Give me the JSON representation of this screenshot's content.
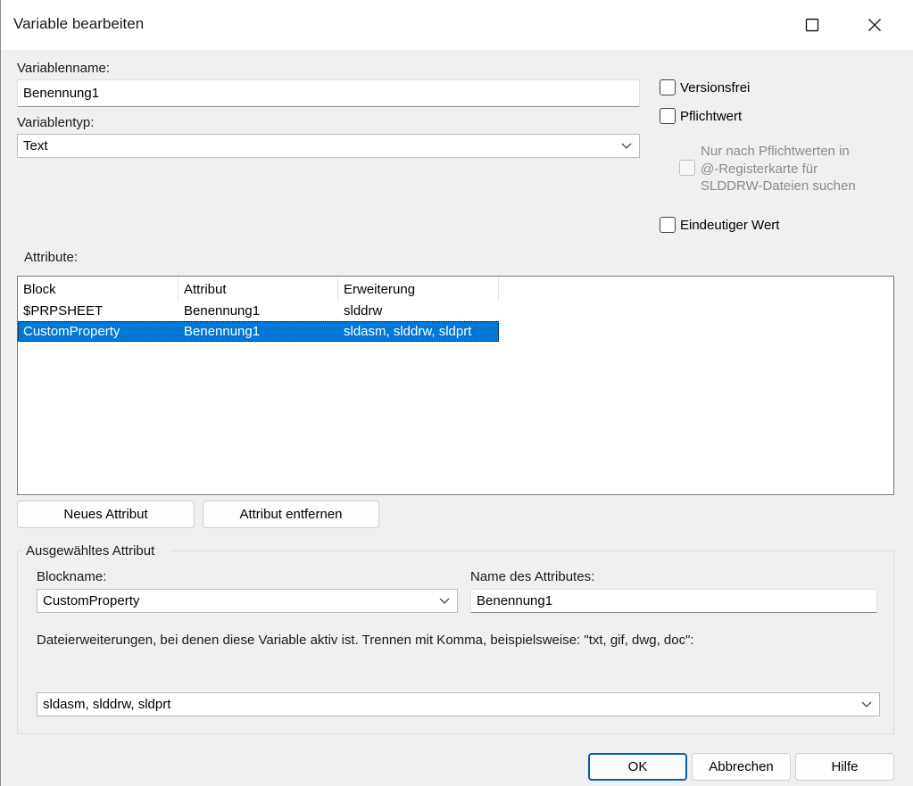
{
  "window": {
    "title": "Variable bearbeiten",
    "maximize_icon": "maximize-icon",
    "close_icon": "close-icon"
  },
  "variable": {
    "name_label": "Variablenname:",
    "name_value": "Benennung1",
    "type_label": "Variablentyp:",
    "type_value": "Text"
  },
  "options": {
    "versionsfrei": {
      "label": "Versionsfrei",
      "checked": false
    },
    "pflichtwert": {
      "label": "Pflichtwert",
      "checked": false
    },
    "pflicht_suche": {
      "line1": "Nur nach Pflichtwerten in",
      "line2": "@-Registerkarte für",
      "line3": "SLDDRW-Dateien suchen",
      "disabled": true
    },
    "eindeutig": {
      "label": "Eindeutiger Wert",
      "checked": false
    }
  },
  "attributes": {
    "label": "Attribute:",
    "columns": [
      "Block",
      "Attribut",
      "Erweiterung"
    ],
    "rows": [
      [
        "$PRPSHEET",
        "Benennung1",
        "slddrw"
      ],
      [
        "CustomProperty",
        "Benennung1",
        "sldasm, slddrw, sldprt"
      ]
    ],
    "selected_row": 1,
    "add_button": "Neues Attribut",
    "remove_button": "Attribut entfernen"
  },
  "selected_attribute": {
    "group_label": "Ausgewähltes Attribut",
    "blockname_label": "Blockname:",
    "blockname_value": "CustomProperty",
    "attrname_label": "Name des Attributes:",
    "attrname_value": "Benennung1",
    "ext_label": "Dateierweiterungen, bei denen diese Variable aktiv ist. Trennen mit Komma, beispielsweise: \"txt, gif, dwg, doc\":",
    "ext_value": "sldasm, slddrw, sldprt"
  },
  "footer": {
    "ok": "OK",
    "cancel": "Abbrechen",
    "help": "Hilfe"
  },
  "colors": {
    "selection": "#0078d7",
    "default_button_border": "#005fb8"
  }
}
